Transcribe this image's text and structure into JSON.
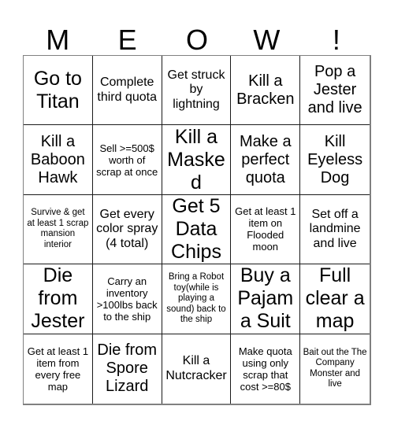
{
  "card": {
    "header_letters": [
      "M",
      "E",
      "O",
      "W",
      "!"
    ],
    "columns": 5,
    "rows": 5,
    "cells": [
      {
        "text": "Go to Titan",
        "size": "s-xl"
      },
      {
        "text": "Complete third quota",
        "size": "s-md"
      },
      {
        "text": "Get struck by lightning",
        "size": "s-md"
      },
      {
        "text": "Kill a Bracken",
        "size": "s-lg"
      },
      {
        "text": "Pop a Jester and live",
        "size": "s-lg"
      },
      {
        "text": "Kill a Baboon Hawk",
        "size": "s-lg"
      },
      {
        "text": "Sell >=500$ worth of scrap at once",
        "size": "s-sm"
      },
      {
        "text": "Kill a Masked",
        "size": "s-xl"
      },
      {
        "text": "Make a perfect quota",
        "size": "s-lg"
      },
      {
        "text": "Kill Eyeless Dog",
        "size": "s-lg"
      },
      {
        "text": "Survive & get at least 1 scrap mansion interior",
        "size": "s-xs"
      },
      {
        "text": "Get every color spray (4 total)",
        "size": "s-md"
      },
      {
        "text": "Get 5 Data Chips",
        "size": "s-xl"
      },
      {
        "text": "Get at least 1 item on Flooded moon",
        "size": "s-sm"
      },
      {
        "text": "Set off a landmine and live",
        "size": "s-md"
      },
      {
        "text": "Die from Jester",
        "size": "s-xl"
      },
      {
        "text": "Carry an inventory >100lbs back to the ship",
        "size": "s-sm"
      },
      {
        "text": "Bring a Robot toy(while is playing a sound) back to the ship",
        "size": "s-xs"
      },
      {
        "text": "Buy a Pajama Suit",
        "size": "s-xl"
      },
      {
        "text": "Full clear a map",
        "size": "s-xl"
      },
      {
        "text": "Get at least 1 item from every free map",
        "size": "s-sm"
      },
      {
        "text": "Die from Spore Lizard",
        "size": "s-lg"
      },
      {
        "text": "Kill a Nutcracker",
        "size": "s-md"
      },
      {
        "text": "Make quota using only scrap that cost >=80$",
        "size": "s-sm"
      },
      {
        "text": "Bait out the The Company Monster and live",
        "size": "s-xs"
      }
    ]
  }
}
